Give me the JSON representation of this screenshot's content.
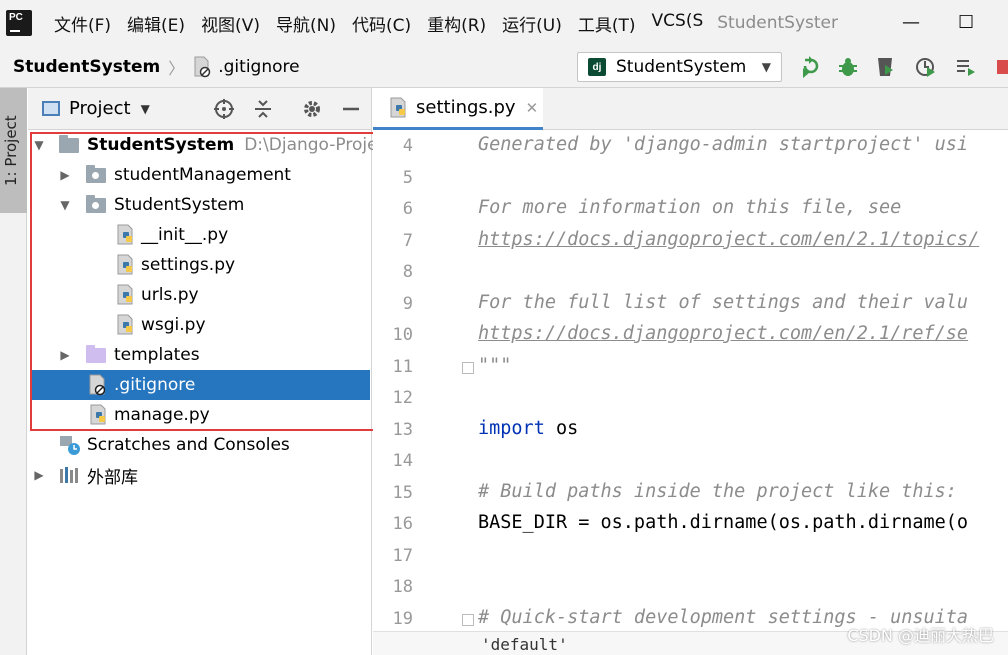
{
  "menubar": {
    "items": [
      "文件(F)",
      "编辑(E)",
      "视图(V)",
      "导航(N)",
      "代码(C)",
      "重构(R)",
      "运行(U)",
      "工具(T)",
      "VCS(S"
    ],
    "window_title": "StudentSyster",
    "minimize": "—",
    "maximize": "☐"
  },
  "navbar": {
    "root": "StudentSystem",
    "file": ".gitignore",
    "run_config": "StudentSystem"
  },
  "sidebar": {
    "tab_label": "1: Project"
  },
  "project_panel": {
    "title": "Project",
    "tree": [
      {
        "label": "StudentSystem",
        "path": "D:\\Django-Proje"
      },
      {
        "label": "studentManagement"
      },
      {
        "label": "StudentSystem"
      },
      {
        "label": "__init__.py"
      },
      {
        "label": "settings.py"
      },
      {
        "label": "urls.py"
      },
      {
        "label": "wsgi.py"
      },
      {
        "label": "templates"
      },
      {
        "label": ".gitignore"
      },
      {
        "label": "manage.py"
      },
      {
        "label": "Scratches and Consoles"
      },
      {
        "label": "外部库"
      }
    ]
  },
  "editor": {
    "tab": "settings.py",
    "lines": [
      {
        "n": "4",
        "text": "Generated by 'django-admin startproject' usi"
      },
      {
        "n": "5",
        "text": ""
      },
      {
        "n": "6",
        "text": "For more information on this file, see"
      },
      {
        "n": "7",
        "text": "https://docs.djangoproject.com/en/2.1/topics/"
      },
      {
        "n": "8",
        "text": ""
      },
      {
        "n": "9",
        "text": "For the full list of settings and their valu"
      },
      {
        "n": "10",
        "text": "https://docs.djangoproject.com/en/2.1/ref/se"
      },
      {
        "n": "11",
        "text": "\"\"\""
      },
      {
        "n": "12",
        "text": ""
      },
      {
        "n": "13",
        "kw": "import",
        "rest": " os"
      },
      {
        "n": "14",
        "text": ""
      },
      {
        "n": "15",
        "text": "# Build paths inside the project like this: "
      },
      {
        "n": "16",
        "text": "BASE_DIR = os.path.dirname(os.path.dirname(o"
      },
      {
        "n": "17",
        "text": ""
      },
      {
        "n": "18",
        "text": ""
      },
      {
        "n": "19",
        "text": "# Quick-start development settings - unsuita"
      }
    ],
    "bottom_text": "'default'",
    "watermark": "CSDN @迪丽大热巴"
  }
}
